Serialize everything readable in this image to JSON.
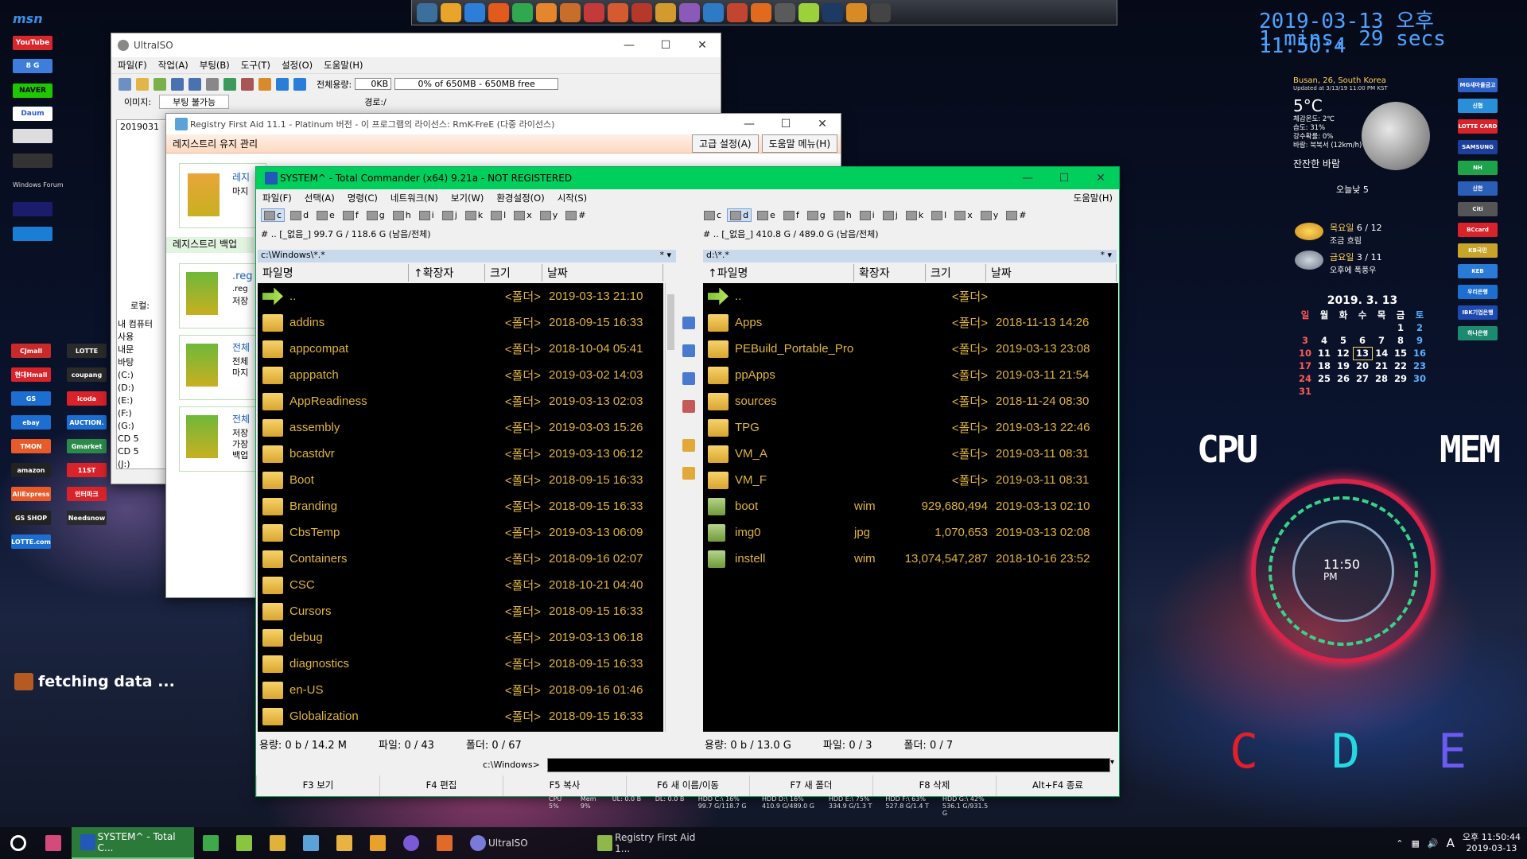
{
  "dock": {
    "icons": [
      "monitor-icon",
      "folder-icon",
      "ie-icon",
      "firefox-icon",
      "chrome-icon",
      "globe-icon",
      "settings-icon",
      "shield-icon",
      "browser-icon",
      "paint-icon",
      "game-icon",
      "tool-icon",
      "pen-icon",
      "gear-icon",
      "media-icon",
      "browser2-icon",
      "search-icon",
      "photoshop-icon",
      "brush-icon",
      "calendar-icon"
    ]
  },
  "clock": {
    "datetime": "2019-03-13 오후 11:50:4",
    "uptime": "1 mins, 29 secs"
  },
  "weather": {
    "location": "Busan, 26, South Korea",
    "updated": "Updated at 3/13/19 11:00 PM KST",
    "temp": "5°C",
    "details": [
      "체감온도: 2℃",
      "습도: 31%",
      "강수확률: 0%",
      "바람: 북북서 (12km/h)"
    ],
    "condition": "잔잔한 바람",
    "today": "오늘낮 5",
    "day1_label": "목요일",
    "day1_temp": "6 / 12",
    "day1_cond": "조금 흐림",
    "day2_label": "금요일",
    "day2_temp": "3 / 11",
    "day2_cond": "오후에 폭풍우"
  },
  "calendar": {
    "title": "2019. 3. 13",
    "days": [
      "일",
      "월",
      "화",
      "수",
      "목",
      "금",
      "토"
    ],
    "weeks": [
      [
        "",
        "",
        "",
        "",
        "",
        "1",
        "2"
      ],
      [
        "3",
        "4",
        "5",
        "6",
        "7",
        "8",
        "9"
      ],
      [
        "10",
        "11",
        "12",
        "13",
        "14",
        "15",
        "16"
      ],
      [
        "17",
        "18",
        "19",
        "20",
        "21",
        "22",
        "23"
      ],
      [
        "24",
        "25",
        "26",
        "27",
        "28",
        "29",
        "30"
      ],
      [
        "31",
        "",
        "",
        "",
        "",
        "",
        ""
      ]
    ]
  },
  "gauge": {
    "cpu": "CPU",
    "mem": "MEM",
    "time": "11:50",
    "ampm": "PM",
    "drives": [
      "C",
      "D",
      "E"
    ]
  },
  "left_desktop": {
    "msn": "msn",
    "youtube": "YouTube",
    "naver": "NAVER",
    "daum": "Daum",
    "windows_forum": "Windows Forum",
    "fetching": "fetching data ...",
    "shops": [
      "CJmall",
      "LOTTE",
      "현대Hmall",
      "coupang",
      "GS",
      "icoda",
      "ebay",
      "AUCTION.",
      "TMON",
      "Gmarket",
      "amazon",
      "11ST",
      "AliExpress",
      "인터파크",
      "GS SHOP",
      "Needsnow",
      "LOTTE.com"
    ]
  },
  "right_desktop": {
    "banks": [
      "MG새마을금고",
      "신협",
      "LOTTE CARD",
      "SAMSUNG",
      "NH",
      "신한",
      "Citi",
      "BCcard",
      "KB국민",
      "KEB",
      "우리은행",
      "IBK기업은행",
      "하나은행"
    ]
  },
  "ultraiso": {
    "title": "UltraISO",
    "menu": [
      "파일(F)",
      "작업(A)",
      "부팅(B)",
      "도구(T)",
      "설정(O)",
      "도움말(H)"
    ],
    "total_label": "전체용량:",
    "total_value": "0KB",
    "bar_text": "0% of 650MB - 650MB free",
    "image_label": "이미지:",
    "boot_value": "부팅 불가능",
    "path_label": "경로:/",
    "tree_item": "2019031",
    "local_label": "로컬:",
    "tree": [
      "내 컴퓨터",
      "사용",
      "내문",
      "바탕",
      "(C:)",
      "(D:)",
      "(E:)",
      "(F:)",
      "(G:)",
      "CD 5",
      "CD 5",
      "(J:)"
    ]
  },
  "rfa": {
    "title": "Registry First Aid 11.1 - Platinum 버전 - 이 프로그램의 라이선스: RmK-FreE (다중 라이선스)",
    "adv_btn": "고급 설정(A)",
    "help_btn": "도움말 메뉴(H)",
    "section1": "레지스트리 유지 관리",
    "section2": "레지스트리 백업",
    "card1": [
      "레지",
      "마지"
    ],
    "card2": [
      ".reg",
      ".reg",
      "저장"
    ],
    "card3": [
      "전체",
      "전체",
      "마지"
    ],
    "card4": [
      "전체",
      "저장",
      "가장",
      "백업"
    ]
  },
  "tc": {
    "title": "SYSTEM^ - Total Commander (x64) 9.21a - NOT REGISTERED",
    "menu": [
      "파일(F)",
      "선택(A)",
      "명령(C)",
      "네트워크(N)",
      "보기(W)",
      "환경설정(O)",
      "시작(S)"
    ],
    "help": "도움말(H)",
    "drives": [
      "c",
      "d",
      "e",
      "f",
      "g",
      "h",
      "i",
      "j",
      "k",
      "l",
      "x",
      "y",
      "#"
    ],
    "left_info": "[_없음_] 99.7 G / 118.6 G (남음/전체)",
    "right_info": "[_없음_] 410.8 G / 489.0 G (남음/전체)",
    "left_path": "c:\\Windows\\*.*",
    "right_path": "d:\\*.*",
    "cols": {
      "name": "파일명",
      "ext": "↑확장자",
      "size": "크기",
      "date": "날짜",
      "rname": "↑파일명",
      "rext": "확장자"
    },
    "left_rows": [
      [
        "..",
        "",
        "<폴더>",
        "2019-03-13 21:10"
      ],
      [
        "addins",
        "",
        "<폴더>",
        "2018-09-15 16:33"
      ],
      [
        "appcompat",
        "",
        "<폴더>",
        "2018-10-04 05:41"
      ],
      [
        "apppatch",
        "",
        "<폴더>",
        "2019-03-02 14:03"
      ],
      [
        "AppReadiness",
        "",
        "<폴더>",
        "2019-03-13 02:03"
      ],
      [
        "assembly",
        "",
        "<폴더>",
        "2019-03-03 15:26"
      ],
      [
        "bcastdvr",
        "",
        "<폴더>",
        "2019-03-13 06:12"
      ],
      [
        "Boot",
        "",
        "<폴더>",
        "2018-09-15 16:33"
      ],
      [
        "Branding",
        "",
        "<폴더>",
        "2018-09-15 16:33"
      ],
      [
        "CbsTemp",
        "",
        "<폴더>",
        "2019-03-13 06:09"
      ],
      [
        "Containers",
        "",
        "<폴더>",
        "2018-09-16 02:07"
      ],
      [
        "CSC",
        "",
        "<폴더>",
        "2018-10-21 04:40"
      ],
      [
        "Cursors",
        "",
        "<폴더>",
        "2018-09-15 16:33"
      ],
      [
        "debug",
        "",
        "<폴더>",
        "2019-03-13 06:18"
      ],
      [
        "diagnostics",
        "",
        "<폴더>",
        "2018-09-15 16:33"
      ],
      [
        "en-US",
        "",
        "<폴더>",
        "2018-09-16 01:46"
      ],
      [
        "Globalization",
        "",
        "<폴더>",
        "2018-09-15 16:33"
      ]
    ],
    "right_rows": [
      [
        "..",
        "",
        "<폴더>",
        ""
      ],
      [
        "Apps",
        "",
        "<폴더>",
        "2018-11-13 14:26"
      ],
      [
        "PEBuild_Portable_Programs_pArAo..",
        "",
        "<폴더>",
        "2019-03-13 23:08"
      ],
      [
        "ppApps",
        "",
        "<폴더>",
        "2019-03-11 21:54"
      ],
      [
        "sources",
        "",
        "<폴더>",
        "2018-11-24 08:30"
      ],
      [
        "TPG",
        "",
        "<폴더>",
        "2019-03-13 22:46"
      ],
      [
        "VM_A",
        "",
        "<폴더>",
        "2019-03-11 08:31"
      ],
      [
        "VM_F",
        "",
        "<폴더>",
        "2019-03-11 08:31"
      ],
      [
        "boot",
        "wim",
        "929,680,494",
        "2019-03-13 02:10"
      ],
      [
        "img0",
        "jpg",
        "1,070,653",
        "2019-03-13 02:08"
      ],
      [
        "instell",
        "wim",
        "13,074,547,287",
        "2018-10-16 23:52"
      ]
    ],
    "left_status": [
      "용량: 0 b / 14.2 M",
      "파일: 0 / 43",
      "폴더: 0 / 67"
    ],
    "right_status": [
      "용량: 0 b / 13.0 G",
      "파일: 0 / 3",
      "폴더: 0 / 7"
    ],
    "cmd_path": "c:\\Windows>",
    "fkeys": [
      "F3 보기",
      "F4 편집",
      "F5 복사",
      "F6 새 이름/이동",
      "F7 새 폴더",
      "F8 삭제",
      "Alt+F4 종료"
    ]
  },
  "taskbar": {
    "tc_label": "SYSTEM^ - Total C...",
    "ultraiso_label": "UltraISO",
    "rfa_label": "Registry First Aid 1...",
    "tray_time": "오후 11:50:44",
    "tray_date": "2019-03-13",
    "ime": "A"
  },
  "hdd_bar": {
    "cpu": "CPU 5%",
    "mem": "Mem 9%",
    "ul": "UL: 0.0 B",
    "dl": "DL: 0.0 B",
    "c": "HDD C:\\ 16% 99.7 G/118.7 G",
    "d": "HDD D:\\ 16% 410.9 G/489.0 G",
    "e": "HDD E:\\ 75% 334.9 G/1.3 T",
    "f": "HDD F:\\ 63% 527.8 G/1.4 T",
    "g": "HDD G:\\ 42% 536.1 G/931.5 G"
  },
  "colors": {
    "tc_title": "#00cf5e",
    "row_text": "#e0b43c",
    "clock": "#4da3ff"
  }
}
